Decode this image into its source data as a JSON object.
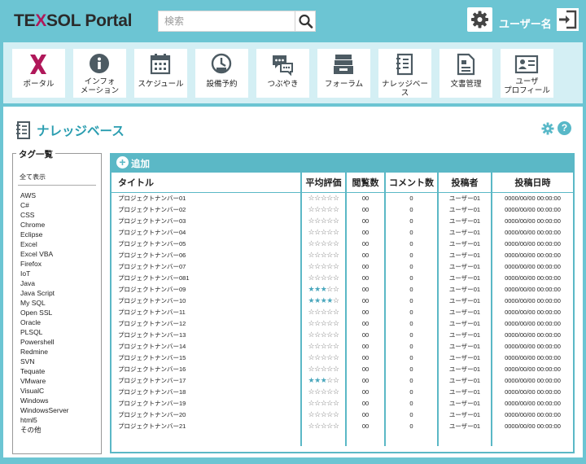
{
  "app": {
    "logo_prefix": "TE",
    "logo_x": "X",
    "logo_suffix": "SOL Portal",
    "user_name": "ユーザー名",
    "search": {
      "placeholder": "検索",
      "value": ""
    },
    "colors": {
      "accent": "#5bb8c6",
      "background": "#6cc5d3",
      "brand": "#b0185a",
      "title": "#2a9db0"
    }
  },
  "nav": {
    "items": [
      {
        "id": "portal",
        "icon": "x-logo-icon",
        "label": "ポータル"
      },
      {
        "id": "info",
        "icon": "info-icon",
        "label": "インフォ\nメーション"
      },
      {
        "id": "schedule",
        "icon": "calendar-icon",
        "label": "スケジュール"
      },
      {
        "id": "facility",
        "icon": "facility-icon",
        "label": "設備予約"
      },
      {
        "id": "tweet",
        "icon": "chat-icon",
        "label": "つぶやき"
      },
      {
        "id": "forum",
        "icon": "forum-icon",
        "label": "フォーラム"
      },
      {
        "id": "knowledge",
        "icon": "knowledge-icon",
        "label": "ナレッジベース"
      },
      {
        "id": "documents",
        "icon": "document-icon",
        "label": "文書管理"
      },
      {
        "id": "profile",
        "icon": "profile-icon",
        "label": "ユーザ\nプロフィール"
      }
    ]
  },
  "page": {
    "title": "ナレッジベース"
  },
  "tags": {
    "legend": "タグ一覧",
    "show_all": "全て表示",
    "items": [
      "AWS",
      "C#",
      "CSS",
      "Chrome",
      "Eclipse",
      "Excel",
      "Excel VBA",
      "Firefox",
      "IoT",
      "Java",
      "Java Script",
      "My SQL",
      "Open SSL",
      "Oracle",
      "PLSQL",
      "Powershell",
      "Redmine",
      "SVN",
      "Tequate",
      "VMware",
      "VisualC",
      "Windows",
      "WindowsServer",
      "html5",
      "その他"
    ]
  },
  "table": {
    "add_label": "追加",
    "headers": {
      "title": "タイトル",
      "rating": "平均評価",
      "views": "閲覧数",
      "comments": "コメント数",
      "author": "投稿者",
      "date": "投稿日時"
    },
    "rows": [
      {
        "title": "プロジェクトナンバー01",
        "rating": 0,
        "views": "00",
        "comments": "0",
        "author": "ユーザー01",
        "date": "0000/00/00 00:00:00"
      },
      {
        "title": "プロジェクトナンバー02",
        "rating": 0,
        "views": "00",
        "comments": "0",
        "author": "ユーザー01",
        "date": "0000/00/00 00:00:00"
      },
      {
        "title": "プロジェクトナンバー03",
        "rating": 0,
        "views": "00",
        "comments": "0",
        "author": "ユーザー01",
        "date": "0000/00/00 00:00:00"
      },
      {
        "title": "プロジェクトナンバー04",
        "rating": 0,
        "views": "00",
        "comments": "0",
        "author": "ユーザー01",
        "date": "0000/00/00 00:00:00"
      },
      {
        "title": "プロジェクトナンバー05",
        "rating": 0,
        "views": "00",
        "comments": "0",
        "author": "ユーザー01",
        "date": "0000/00/00 00:00:00"
      },
      {
        "title": "プロジェクトナンバー06",
        "rating": 0,
        "views": "00",
        "comments": "0",
        "author": "ユーザー01",
        "date": "0000/00/00 00:00:00"
      },
      {
        "title": "プロジェクトナンバー07",
        "rating": 0,
        "views": "00",
        "comments": "0",
        "author": "ユーザー01",
        "date": "0000/00/00 00:00:00"
      },
      {
        "title": "プロジェクトナンバー081",
        "rating": 0,
        "views": "00",
        "comments": "0",
        "author": "ユーザー01",
        "date": "0000/00/00 00:00:00"
      },
      {
        "title": "プロジェクトナンバー09",
        "rating": 3,
        "views": "00",
        "comments": "0",
        "author": "ユーザー01",
        "date": "0000/00/00 00:00:00"
      },
      {
        "title": "プロジェクトナンバー10",
        "rating": 4,
        "views": "00",
        "comments": "0",
        "author": "ユーザー01",
        "date": "0000/00/00 00:00:00"
      },
      {
        "title": "プロジェクトナンバー11",
        "rating": 0,
        "views": "00",
        "comments": "0",
        "author": "ユーザー01",
        "date": "0000/00/00 00:00:00"
      },
      {
        "title": "プロジェクトナンバー12",
        "rating": 0,
        "views": "00",
        "comments": "0",
        "author": "ユーザー01",
        "date": "0000/00/00 00:00:00"
      },
      {
        "title": "プロジェクトナンバー13",
        "rating": 0,
        "views": "00",
        "comments": "0",
        "author": "ユーザー01",
        "date": "0000/00/00 00:00:00"
      },
      {
        "title": "プロジェクトナンバー14",
        "rating": 0,
        "views": "00",
        "comments": "0",
        "author": "ユーザー01",
        "date": "0000/00/00 00:00:00"
      },
      {
        "title": "プロジェクトナンバー15",
        "rating": 0,
        "views": "00",
        "comments": "0",
        "author": "ユーザー01",
        "date": "0000/00/00 00:00:00"
      },
      {
        "title": "プロジェクトナンバー16",
        "rating": 0,
        "views": "00",
        "comments": "0",
        "author": "ユーザー01",
        "date": "0000/00/00 00:00:00"
      },
      {
        "title": "プロジェクトナンバー17",
        "rating": 3,
        "views": "00",
        "comments": "0",
        "author": "ユーザー01",
        "date": "0000/00/00 00:00:00"
      },
      {
        "title": "プロジェクトナンバー18",
        "rating": 0,
        "views": "00",
        "comments": "0",
        "author": "ユーザー01",
        "date": "0000/00/00 00:00:00"
      },
      {
        "title": "プロジェクトナンバー19",
        "rating": 0,
        "views": "00",
        "comments": "0",
        "author": "ユーザー01",
        "date": "0000/00/00 00:00:00"
      },
      {
        "title": "プロジェクトナンバー20",
        "rating": 0,
        "views": "00",
        "comments": "0",
        "author": "ユーザー01",
        "date": "0000/00/00 00:00:00"
      },
      {
        "title": "プロジェクトナンバー21",
        "rating": 0,
        "views": "00",
        "comments": "0",
        "author": "ユーザー01",
        "date": "0000/00/00 00:00:00"
      }
    ]
  }
}
